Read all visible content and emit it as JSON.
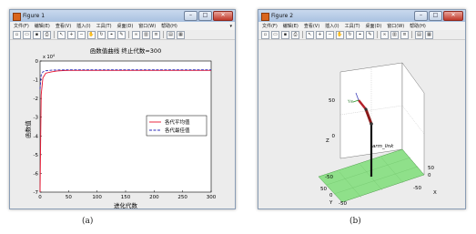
{
  "window_a": {
    "title": "Figure 1",
    "menu": [
      "文件(F)",
      "编辑(E)",
      "查看(V)",
      "插入(I)",
      "工具(T)",
      "桌面(D)",
      "窗口(W)",
      "帮助(H)"
    ],
    "toolbar_icons": [
      "new-icon",
      "open-icon",
      "save-icon",
      "print-icon",
      "pointer-icon",
      "zoom-in-icon",
      "zoom-out-icon",
      "pan-icon",
      "rotate-icon",
      "data-cursor-icon",
      "brush-icon",
      "link-icon",
      "colorbar-icon",
      "legend-icon",
      "hide-tools-icon",
      "show-tools-icon"
    ]
  },
  "window_b": {
    "title": "Figure 2",
    "menu": [
      "文件(F)",
      "编辑(E)",
      "查看(V)",
      "插入(I)",
      "工具(T)",
      "桌面(D)",
      "窗口(W)",
      "帮助(H)"
    ],
    "toolbar_icons": [
      "new-icon",
      "open-icon",
      "save-icon",
      "print-icon",
      "pointer-icon",
      "zoom-in-icon",
      "zoom-out-icon",
      "pan-icon",
      "rotate-icon",
      "data-cursor-icon",
      "brush-icon",
      "link-icon",
      "colorbar-icon",
      "legend-icon",
      "hide-tools-icon",
      "show-tools-icon"
    ]
  },
  "plot_a": {
    "title": "函数值曲线  终止代数=300",
    "xlabel": "进化代数",
    "ylabel": "函数值",
    "exponent": "x 10",
    "exponent_power": "4",
    "x_ticks": [
      "0",
      "50",
      "100",
      "150",
      "200",
      "250",
      "300"
    ],
    "y_ticks": [
      "0",
      "-1",
      "-2",
      "-3",
      "-4",
      "-5",
      "-6",
      "-7"
    ],
    "legend": [
      "各代平均值",
      "各代最佳值"
    ],
    "colors": {
      "average": "#e8112d",
      "best": "#2b2bb8"
    }
  },
  "plot_b": {
    "z_label": "Z",
    "x_label": "X",
    "y_label": "Y",
    "z_ticks": [
      "50",
      "0",
      "-50"
    ],
    "y_ticks": [
      "50",
      "0",
      "-50"
    ],
    "x_ticks": [
      "50",
      "0",
      "-50"
    ],
    "link_label": "arm_link",
    "floor_color": "#8fe08a"
  },
  "captions": {
    "a": "(a)",
    "b": "(b)"
  },
  "chart_data": {
    "type": "line",
    "title": "函数值曲线  终止代数=300",
    "xlabel": "进化代数",
    "ylabel": "函数值",
    "xlim": [
      0,
      300
    ],
    "ylim": [
      -70000,
      0
    ],
    "x": [
      0,
      2,
      5,
      10,
      20,
      30,
      40,
      50,
      100,
      150,
      200,
      250,
      300
    ],
    "series": [
      {
        "name": "各代平均值",
        "values": [
          -70000,
          -18000,
          -9000,
          -6500,
          -5800,
          -5300,
          -5100,
          -5000,
          -5000,
          -5000,
          -5000,
          -5000,
          -5000
        ]
      },
      {
        "name": "各代最佳值",
        "values": [
          -15000,
          -7500,
          -5800,
          -5200,
          -4900,
          -4800,
          -4750,
          -4700,
          -4700,
          -4700,
          -4700,
          -4700,
          -4700
        ]
      }
    ],
    "grid": false,
    "legend_position": "right"
  }
}
